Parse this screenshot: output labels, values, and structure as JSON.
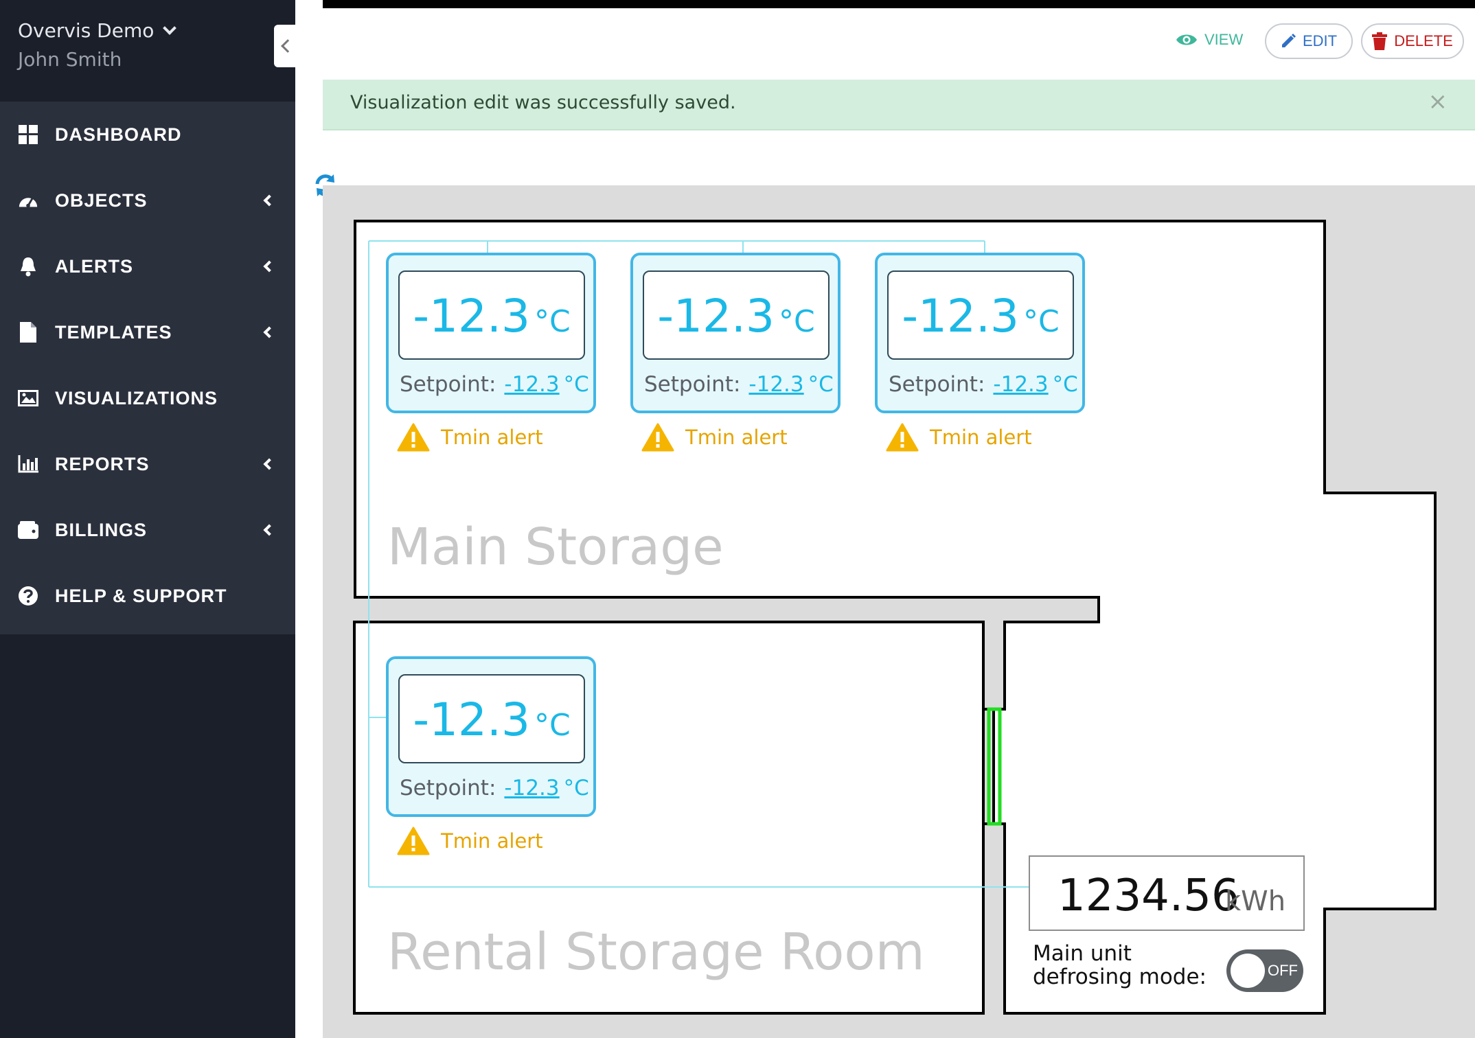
{
  "header": {
    "account": "Overvis Demo",
    "user": "John Smith"
  },
  "sidebar": {
    "items": [
      {
        "label": "DASHBOARD",
        "icon": "dashboard-icon",
        "has_submenu": false
      },
      {
        "label": "OBJECTS",
        "icon": "gauge-icon",
        "has_submenu": true
      },
      {
        "label": "ALERTS",
        "icon": "bell-icon",
        "has_submenu": true
      },
      {
        "label": "TEMPLATES",
        "icon": "file-icon",
        "has_submenu": true
      },
      {
        "label": "VISUALIZATIONS",
        "icon": "image-icon",
        "has_submenu": false
      },
      {
        "label": "REPORTS",
        "icon": "bar-chart-icon",
        "has_submenu": true
      },
      {
        "label": "BILLINGS",
        "icon": "wallet-icon",
        "has_submenu": true
      },
      {
        "label": "HELP & SUPPORT",
        "icon": "question-circle-icon",
        "has_submenu": false
      }
    ]
  },
  "toolbar": {
    "view_label": "VIEW",
    "edit_label": "EDIT",
    "delete_label": "DELETE"
  },
  "alert": {
    "message": "Visualization edit was successfully saved.",
    "close": "×"
  },
  "rooms": {
    "main": "Main Storage",
    "rental": "Rental Storage Room"
  },
  "sensors": [
    {
      "temp": "-12.3",
      "unit": "°C",
      "setpoint_label": "Setpoint:",
      "setpoint": "-12.3",
      "setpoint_unit": "°C",
      "alert": "Tmin alert"
    },
    {
      "temp": "-12.3",
      "unit": "°C",
      "setpoint_label": "Setpoint:",
      "setpoint": "-12.3",
      "setpoint_unit": "°C",
      "alert": "Tmin alert"
    },
    {
      "temp": "-12.3",
      "unit": "°C",
      "setpoint_label": "Setpoint:",
      "setpoint": "-12.3",
      "setpoint_unit": "°C",
      "alert": "Tmin alert"
    },
    {
      "temp": "-12.3",
      "unit": "°C",
      "setpoint_label": "Setpoint:",
      "setpoint": "-12.3",
      "setpoint_unit": "°C",
      "alert": "Tmin alert"
    }
  ],
  "energy": {
    "value": "1234.56",
    "unit": "kWh"
  },
  "defrost": {
    "label_line1": "Main unit",
    "label_line2": "defrosing mode:",
    "state": "OFF"
  },
  "colors": {
    "sidebar_bg": "#1b1f2a",
    "menu_bg": "#2b303d",
    "accent_cyan": "#1ab8e6",
    "alert_bg": "#d4eedd",
    "warning": "#e6a400",
    "door_green": "#22dd22"
  }
}
